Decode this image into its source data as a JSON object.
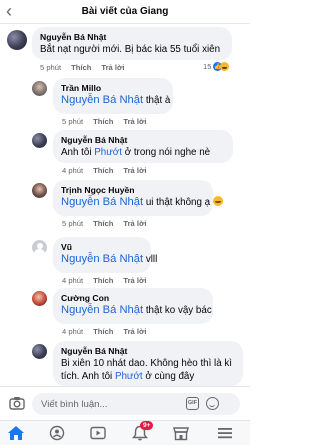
{
  "header": {
    "title": "Bài viết của Giang"
  },
  "comments": [
    {
      "author": "Nguyễn Bá Nhật",
      "text": "Bắt nạt người mới. Bị bác kia 55 tuổi xiên",
      "time": "5 phút",
      "like": "Thích",
      "reply": "Trả lời",
      "reaction_count": "15"
    },
    {
      "author": "Trần Millo",
      "tag": "Nguyễn Bá Nhật",
      "text": "thật à",
      "time": "5 phút",
      "like": "Thích",
      "reply": "Trả lời"
    },
    {
      "author": "Nguyễn Bá Nhật",
      "text_a": "Anh tôi",
      "link": "Phướt",
      "text_b": "ở trong nói nghe nè",
      "time": "4 phút",
      "like": "Thích",
      "reply": "Trả lời"
    },
    {
      "author": "Trịnh Ngọc Huyền",
      "tag": "Nguyễn Bá Nhật",
      "text": "ui thật không ạ",
      "time": "5 phút",
      "like": "Thích",
      "reply": "Trả lời"
    },
    {
      "author": "Vũ",
      "tag": "Nguyễn Bá Nhật",
      "text": "vlll",
      "time": "4 phút",
      "like": "Thích",
      "reply": "Trả lời"
    },
    {
      "author": "Cường Con",
      "tag": "Nguyễn Bá Nhật",
      "text": "thật ko vậy bác",
      "time": "4 phút",
      "like": "Thích",
      "reply": "Trả lời"
    },
    {
      "author": "Nguyễn Bá Nhật",
      "line1": "Bi xiên 10 nhát dao. Không hèo thì là kì",
      "line2_a": "tích. Anh tôi",
      "link": "Phướt",
      "line2_b": "ở cùng đây"
    }
  ],
  "composer": {
    "placeholder": "Viết bình luận...",
    "gif_label": "GIF"
  },
  "tabbar": {
    "notification_badge": "9+"
  },
  "colors": {
    "accent": "#1877f2",
    "link": "#1d64d6",
    "badge": "#e41e3f"
  }
}
